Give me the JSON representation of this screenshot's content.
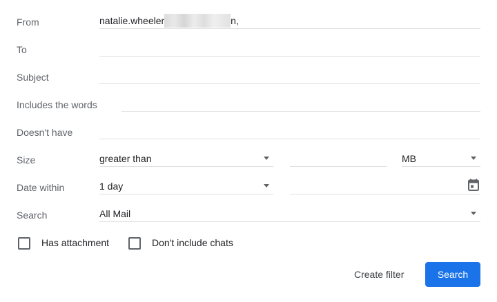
{
  "labels": {
    "from": "From",
    "to": "To",
    "subject": "Subject",
    "includes": "Includes the words",
    "doesnt_have": "Doesn't have",
    "size": "Size",
    "date_within": "Date within",
    "search": "Search"
  },
  "fields": {
    "from_value_prefix": "natalie.wheeler",
    "from_value_suffix": "n,",
    "to_value": "",
    "subject_value": "",
    "includes_value": "",
    "doesnt_have_value": "",
    "size_operator": "greater than",
    "size_value": "",
    "size_unit": "MB",
    "date_within": "1 day",
    "date_value": "",
    "search_scope": "All Mail"
  },
  "checkboxes": {
    "has_attachment": "Has attachment",
    "dont_include_chats": "Don't include chats"
  },
  "buttons": {
    "create_filter": "Create filter",
    "search": "Search"
  },
  "colors": {
    "primary": "#1a73e8",
    "label": "#5f6368",
    "divider": "#e0e0e0"
  },
  "icons": {
    "dropdown": "caret-down-icon",
    "calendar": "calendar-icon"
  }
}
